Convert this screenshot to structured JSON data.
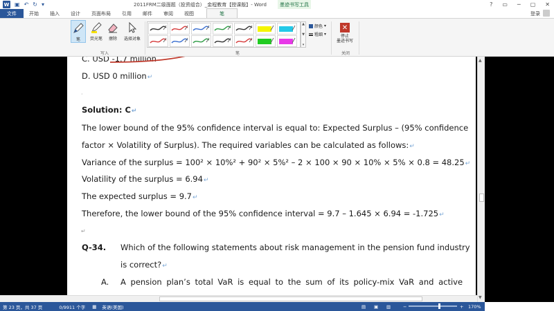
{
  "window": {
    "title": "2011FRM二级面题（投资组合）_金程教育【授课版】- Word",
    "context_tab_group": "墨迹书写工具",
    "login": "登录",
    "controls": [
      "?",
      "▭",
      "─",
      "▢",
      "✕"
    ]
  },
  "tabs": [
    {
      "label": "文件"
    },
    {
      "label": "开始"
    },
    {
      "label": "插入"
    },
    {
      "label": "设计"
    },
    {
      "label": "页面布局"
    },
    {
      "label": "引用"
    },
    {
      "label": "邮件"
    },
    {
      "label": "审阅"
    },
    {
      "label": "视图"
    },
    {
      "label": "笔"
    }
  ],
  "ribbon": {
    "write_group": {
      "label": "写入",
      "buttons": [
        {
          "label": "笔"
        },
        {
          "label": "荧光笔"
        },
        {
          "label": "擦除"
        },
        {
          "label": "选择对象"
        }
      ]
    },
    "pen_group": {
      "label": "笔",
      "color_label": "颜色",
      "thickness_label": "粗细",
      "pen_colors": [
        "#333333",
        "#d63b3b",
        "#3a6fd0",
        "#2e9b45",
        "#333333",
        "#d63b3b",
        "#3a6fd0",
        "#2e9b45",
        "#333333",
        "#d63b3b",
        "#3a6fd0",
        "#2e9b45"
      ],
      "highlighter_colors": [
        "#f5f500",
        "#23c9e8",
        "#22cc22",
        "#e838e8"
      ]
    },
    "close_group": {
      "label": "关闭",
      "stop_label_1": "停止",
      "stop_label_2": "墨迹书写"
    }
  },
  "document": {
    "lines": [
      "C.   USD -1.7 million",
      "D.   USD 0 million",
      "Solution: C",
      "The lower bound of the 95% confidence interval is equal to: Expected Surplus – (95% confidence",
      "factor × Volatility of Surplus). The required variables can be calculated as follows:",
      "Variance of the surplus = 100² × 10%² + 90² × 5%² – 2 × 100 × 90 × 10% × 5% × 0.8 = 48.25",
      "Volatility of the surplus = 6.94",
      "The expected surplus = 9.7",
      "Therefore, the lower bound of the 95% confidence interval = 9.7 – 1.645 × 6.94 = -1.725",
      "Q-34.",
      "Which of the following statements about risk management in the pension fund industry",
      "is correct?",
      "A.",
      "A pension plan’s total VaR is equal to the sum of its policy-mix VaR and active"
    ],
    "para_mark": "↵"
  },
  "status": {
    "page": "第 23 页，共 37 页",
    "words": "0/9911 个字",
    "language": "英语(美国)",
    "zoom": "170%",
    "zoom_minus": "−",
    "zoom_plus": "+"
  }
}
